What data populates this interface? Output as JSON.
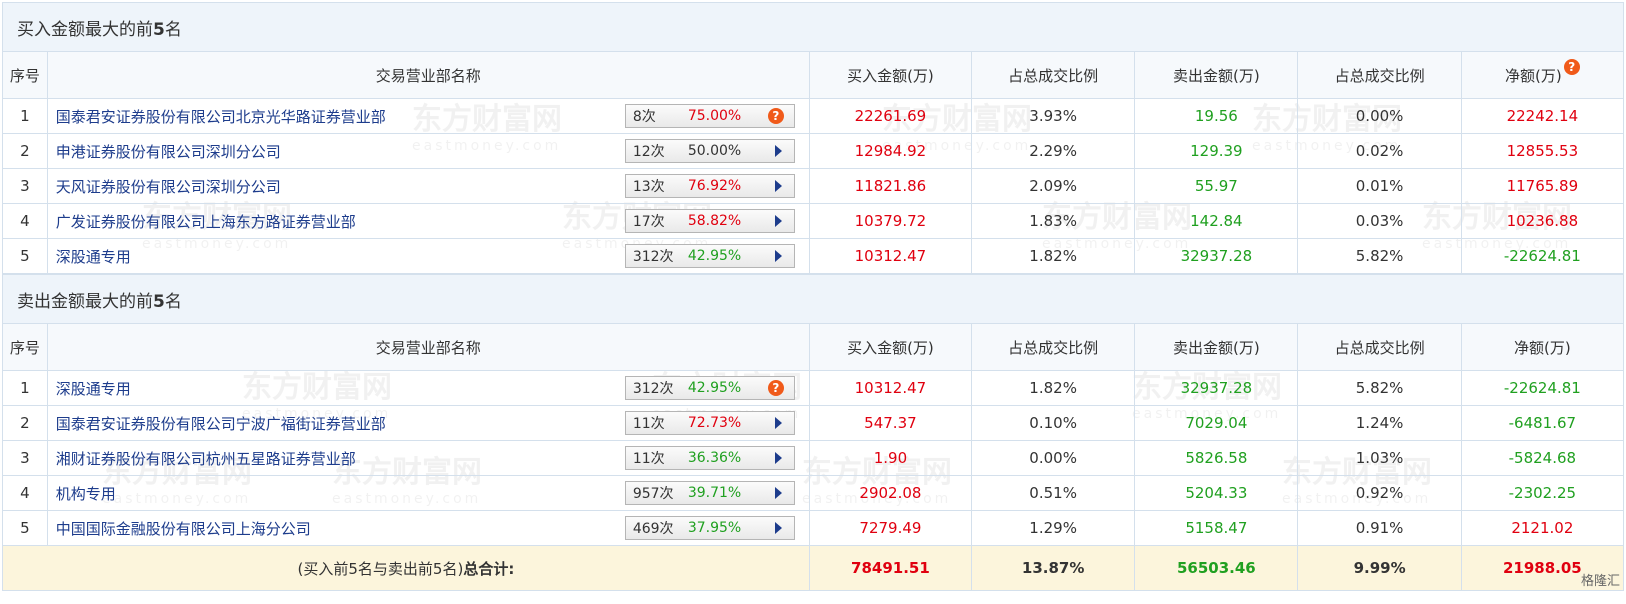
{
  "buy_section": {
    "title_prefix": "买入金额最大的前",
    "title_num": "5",
    "title_suffix": "名",
    "headers": {
      "seq": "序号",
      "name": "交易营业部名称",
      "buy": "买入金额(万)",
      "buy_ratio": "占总成交比例",
      "sell": "卖出金额(万)",
      "sell_ratio": "占总成交比例",
      "net": "净额(万)"
    },
    "rows": [
      {
        "seq": "1",
        "name": "国泰君安证券股份有限公司北京光华路证券营业部",
        "count": "8次",
        "pct": "75.00%",
        "pct_color": "red",
        "icon": "question",
        "buy": "22261.69",
        "buy_ratio": "3.93%",
        "sell": "19.56",
        "sell_ratio": "0.00%",
        "net": "22242.14",
        "net_color": "red"
      },
      {
        "seq": "2",
        "name": "申港证券股份有限公司深圳分公司",
        "count": "12次",
        "pct": "50.00%",
        "pct_color": "dark",
        "icon": "arrow",
        "buy": "12984.92",
        "buy_ratio": "2.29%",
        "sell": "129.39",
        "sell_ratio": "0.02%",
        "net": "12855.53",
        "net_color": "red"
      },
      {
        "seq": "3",
        "name": "天风证券股份有限公司深圳分公司",
        "count": "13次",
        "pct": "76.92%",
        "pct_color": "red",
        "icon": "arrow",
        "buy": "11821.86",
        "buy_ratio": "2.09%",
        "sell": "55.97",
        "sell_ratio": "0.01%",
        "net": "11765.89",
        "net_color": "red"
      },
      {
        "seq": "4",
        "name": "广发证券股份有限公司上海东方路证券营业部",
        "count": "17次",
        "pct": "58.82%",
        "pct_color": "red",
        "icon": "arrow",
        "buy": "10379.72",
        "buy_ratio": "1.83%",
        "sell": "142.84",
        "sell_ratio": "0.03%",
        "net": "10236.88",
        "net_color": "red"
      },
      {
        "seq": "5",
        "name": "深股通专用",
        "count": "312次",
        "pct": "42.95%",
        "pct_color": "green",
        "icon": "arrow",
        "buy": "10312.47",
        "buy_ratio": "1.82%",
        "sell": "32937.28",
        "sell_ratio": "5.82%",
        "net": "-22624.81",
        "net_color": "green"
      }
    ]
  },
  "sell_section": {
    "title_prefix": "卖出金额最大的前",
    "title_num": "5",
    "title_suffix": "名",
    "headers": {
      "seq": "序号",
      "name": "交易营业部名称",
      "buy": "买入金额(万)",
      "buy_ratio": "占总成交比例",
      "sell": "卖出金额(万)",
      "sell_ratio": "占总成交比例",
      "net": "净额(万)"
    },
    "rows": [
      {
        "seq": "1",
        "name": "深股通专用",
        "count": "312次",
        "pct": "42.95%",
        "pct_color": "green",
        "icon": "question",
        "buy": "10312.47",
        "buy_ratio": "1.82%",
        "sell": "32937.28",
        "sell_ratio": "5.82%",
        "net": "-22624.81",
        "net_color": "green"
      },
      {
        "seq": "2",
        "name": "国泰君安证券股份有限公司宁波广福街证券营业部",
        "count": "11次",
        "pct": "72.73%",
        "pct_color": "red",
        "icon": "arrow",
        "buy": "547.37",
        "buy_ratio": "0.10%",
        "sell": "7029.04",
        "sell_ratio": "1.24%",
        "net": "-6481.67",
        "net_color": "green"
      },
      {
        "seq": "3",
        "name": "湘财证券股份有限公司杭州五星路证券营业部",
        "count": "11次",
        "pct": "36.36%",
        "pct_color": "green",
        "icon": "arrow",
        "buy": "1.90",
        "buy_ratio": "0.00%",
        "sell": "5826.58",
        "sell_ratio": "1.03%",
        "net": "-5824.68",
        "net_color": "green"
      },
      {
        "seq": "4",
        "name": "机构专用",
        "count": "957次",
        "pct": "39.71%",
        "pct_color": "green",
        "icon": "arrow",
        "buy": "2902.08",
        "buy_ratio": "0.51%",
        "sell": "5204.33",
        "sell_ratio": "0.92%",
        "net": "-2302.25",
        "net_color": "green"
      },
      {
        "seq": "5",
        "name": "中国国际金融股份有限公司上海分公司",
        "count": "469次",
        "pct": "37.95%",
        "pct_color": "green",
        "icon": "arrow",
        "buy": "7279.49",
        "buy_ratio": "1.29%",
        "sell": "5158.47",
        "sell_ratio": "0.91%",
        "net": "2121.02",
        "net_color": "red"
      }
    ]
  },
  "total": {
    "label_prefix": "(买入前5名与卖出前5名)",
    "label_bold": "总合计:",
    "buy": "78491.51",
    "buy_ratio": "13.87%",
    "sell": "56503.46",
    "sell_ratio": "9.99%",
    "net": "21988.05"
  },
  "net_help_icon": "?",
  "watermark": {
    "cn": "东方财富网",
    "en": "eastmoney.com"
  },
  "corner_logo": "格隆汇",
  "colors": {
    "red": "#e0000f",
    "green": "#20a020",
    "link": "#1d3c8c",
    "header_bg": "#eef4fa",
    "total_bg": "#fcf5dc"
  }
}
